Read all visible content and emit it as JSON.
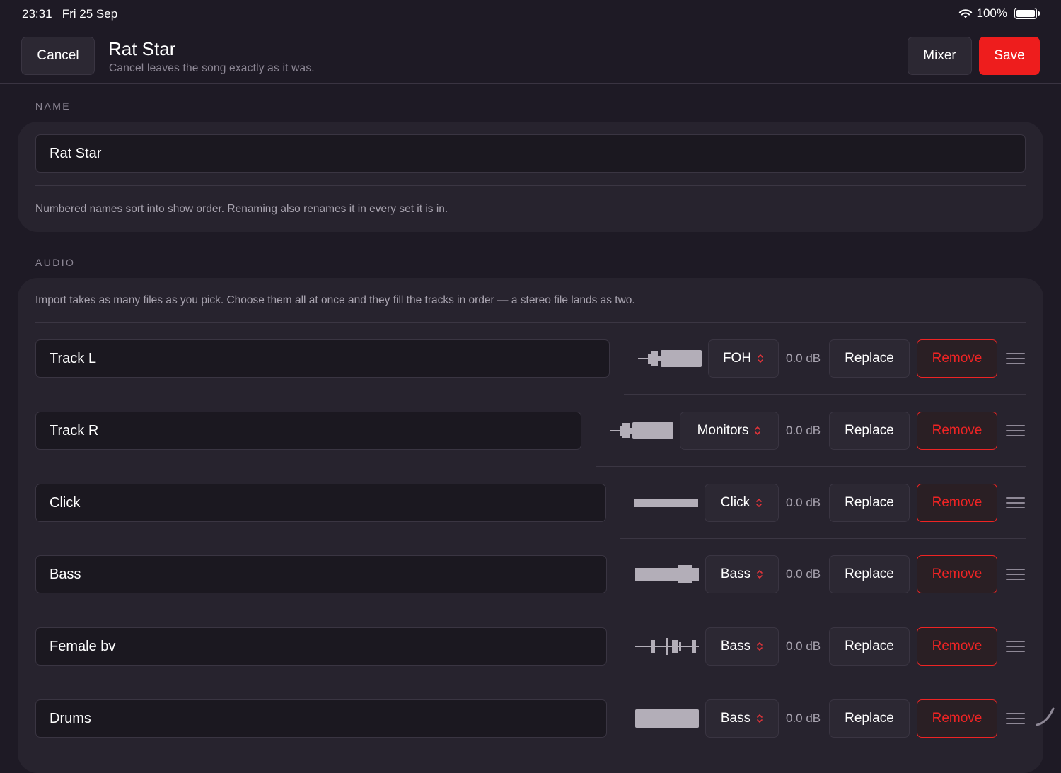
{
  "status": {
    "time": "23:31",
    "date": "Fri 25 Sep",
    "battery": "100%"
  },
  "header": {
    "cancel_label": "Cancel",
    "title": "Rat Star",
    "subtitle": "Cancel leaves the song exactly as it was.",
    "mixer_label": "Mixer",
    "save_label": "Save"
  },
  "name_section": {
    "label": "NAME",
    "value": "Rat Star",
    "hint": "Numbered names sort into show order. Renaming also renames it in every set it is in."
  },
  "audio_section": {
    "label": "AUDIO",
    "hint": "Import takes as many files as you pick. Choose them all at once and they fill the tracks in order — a stereo file lands as two."
  },
  "tracks": [
    {
      "name": "Track L",
      "output": "FOH",
      "gain": "0.0 dB",
      "replace": "Replace",
      "remove": "Remove"
    },
    {
      "name": "Track R",
      "output": "Monitors",
      "gain": "0.0 dB",
      "replace": "Replace",
      "remove": "Remove"
    },
    {
      "name": "Click",
      "output": "Click",
      "gain": "0.0 dB",
      "replace": "Replace",
      "remove": "Remove"
    },
    {
      "name": "Bass",
      "output": "Bass",
      "gain": "0.0 dB",
      "replace": "Replace",
      "remove": "Remove"
    },
    {
      "name": "Female bv",
      "output": "Bass",
      "gain": "0.0 dB",
      "replace": "Replace",
      "remove": "Remove"
    },
    {
      "name": "Drums",
      "output": "Bass",
      "gain": "0.0 dB",
      "replace": "Replace",
      "remove": "Remove"
    }
  ],
  "colors": {
    "background": "#1e1a25",
    "card": "#27232e",
    "accent": "#ee1d1d",
    "waveform": "#b3aeb8"
  }
}
